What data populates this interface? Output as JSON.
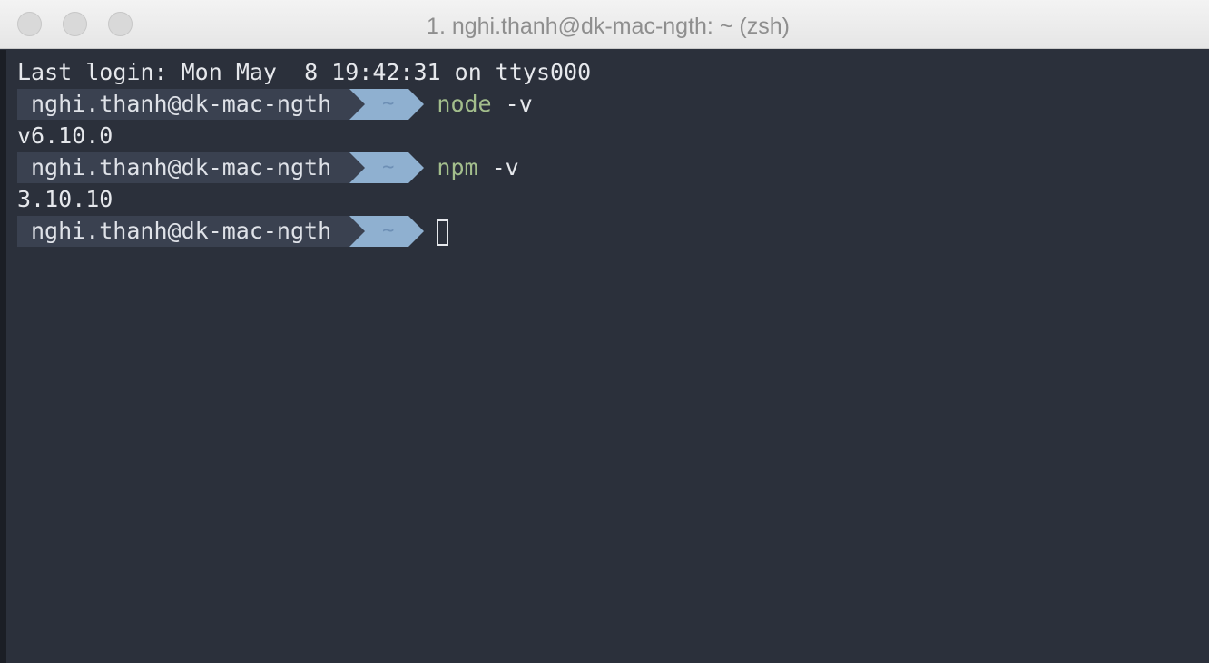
{
  "window": {
    "title": "1. nghi.thanh@dk-mac-ngth: ~ (zsh)"
  },
  "terminal": {
    "last_login": "Last login: Mon May  8 19:42:31 on ttys000",
    "prompt_user": "nghi.thanh@dk-mac-ngth",
    "prompt_dir": "~",
    "commands": [
      {
        "cmd": "node",
        "arg": " -v",
        "output": "v6.10.0"
      },
      {
        "cmd": "npm",
        "arg": " -v",
        "output": "3.10.10"
      }
    ]
  },
  "colors": {
    "background": "#2b303b",
    "prompt_user_bg": "#3a4150",
    "prompt_dir_bg": "#8fb0d0",
    "command": "#a3be8c",
    "text": "#e6e8ec"
  }
}
